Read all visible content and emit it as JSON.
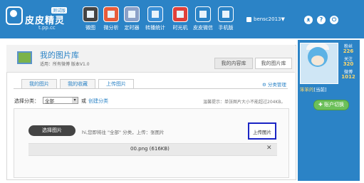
{
  "app": {
    "brand": "皮皮精灵",
    "tag": "测试版",
    "url": "t.pp.cc"
  },
  "nav": [
    {
      "label": "微图",
      "icon": "camera-icon",
      "color": "#444444"
    },
    {
      "label": "微分析",
      "icon": "pie-chart-icon",
      "color": "#e85c3a"
    },
    {
      "label": "定时器",
      "icon": "clock-icon",
      "color": "#8aa0c8"
    },
    {
      "label": "转播统计",
      "icon": "line-chart-icon",
      "color": "#3a8fd6"
    },
    {
      "label": "时光机",
      "icon": "spiral-icon",
      "color": "#e0403a"
    },
    {
      "label": "皮皮微信",
      "icon": "pp-chat-icon",
      "color": "#2b83c6"
    },
    {
      "label": "手机版",
      "icon": "mobile-icon",
      "color": "#2b83c6"
    }
  ],
  "user": {
    "name": "bensc2013▼"
  },
  "topicons": [
    "bear-icon",
    "help-icon",
    "power-icon"
  ],
  "page": {
    "title": "我的图片库",
    "subtitle": "适用：所有微博 版本V1.0"
  },
  "rtabs": [
    "我的内容库",
    "我的图片库"
  ],
  "tabs": [
    "我的图片",
    "我的收藏",
    "上传图片"
  ],
  "sort_manage": "分类管理",
  "select": {
    "label": "选择分类：",
    "value": "全部",
    "or": "或",
    "create": "创建分类"
  },
  "hint": "温馨提示：单张图片大小不能超过204KB。",
  "choose_btn": "选择图片",
  "upload_tip": "hi,您即将往 \"全部\" 分类，上传：张图片",
  "upload_btn": "上传图片",
  "file": {
    "name": "00.png (616KB)"
  },
  "profile": {
    "stats": [
      {
        "label": "粉丝",
        "value": "226"
      },
      {
        "label": "关注",
        "value": "320"
      },
      {
        "label": "微博",
        "value": "1012"
      }
    ],
    "nick": "笨笨的",
    "nick_tag": "[当前]",
    "switch_btn": "账户切换"
  }
}
